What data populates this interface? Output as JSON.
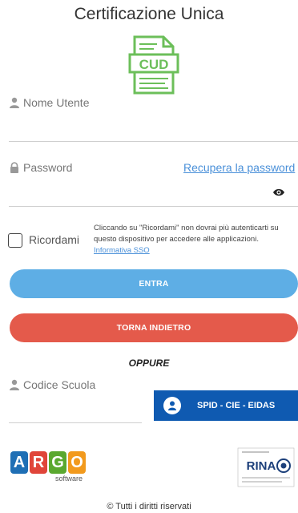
{
  "page": {
    "title": "Certificazione Unica",
    "cud_logo_text": "CUD",
    "username_placeholder": "Nome Utente",
    "password_placeholder": "Password",
    "recover_password_link": "Recupera la password",
    "remember_label": "Ricordami",
    "remember_note": "Cliccando su \"Ricordami\" non dovrai più autenticarti su questo dispositivo per accedere alle applicazioni.",
    "sso_info_link": "Informativa SSO",
    "enter_button": "ENTRA",
    "back_button": "TORNA INDIETRO",
    "or_separator": "OPPURE",
    "school_code_placeholder": "Codice Scuola",
    "spid_button": "SPID - CIE - EIDAS",
    "footer": "© Tutti i diritti riservati"
  },
  "argo_logo": {
    "letters": [
      "A",
      "R",
      "G",
      "O"
    ],
    "letter_colors": [
      "#1f6fb5",
      "#e0453a",
      "#5aa82f",
      "#f29a1d"
    ],
    "subtitle": "software"
  },
  "rina_logo": {
    "text": "RINA"
  },
  "icons": {
    "user": "user-icon",
    "lock": "lock-icon",
    "eye": "eye-icon",
    "school": "user-icon",
    "spid": "spid-person-icon"
  },
  "colors": {
    "enter": "#5eaee5",
    "back": "#e45a4b",
    "spid": "#0f5ab1",
    "link": "#4a90d9",
    "cud": "#6cbf5a"
  }
}
